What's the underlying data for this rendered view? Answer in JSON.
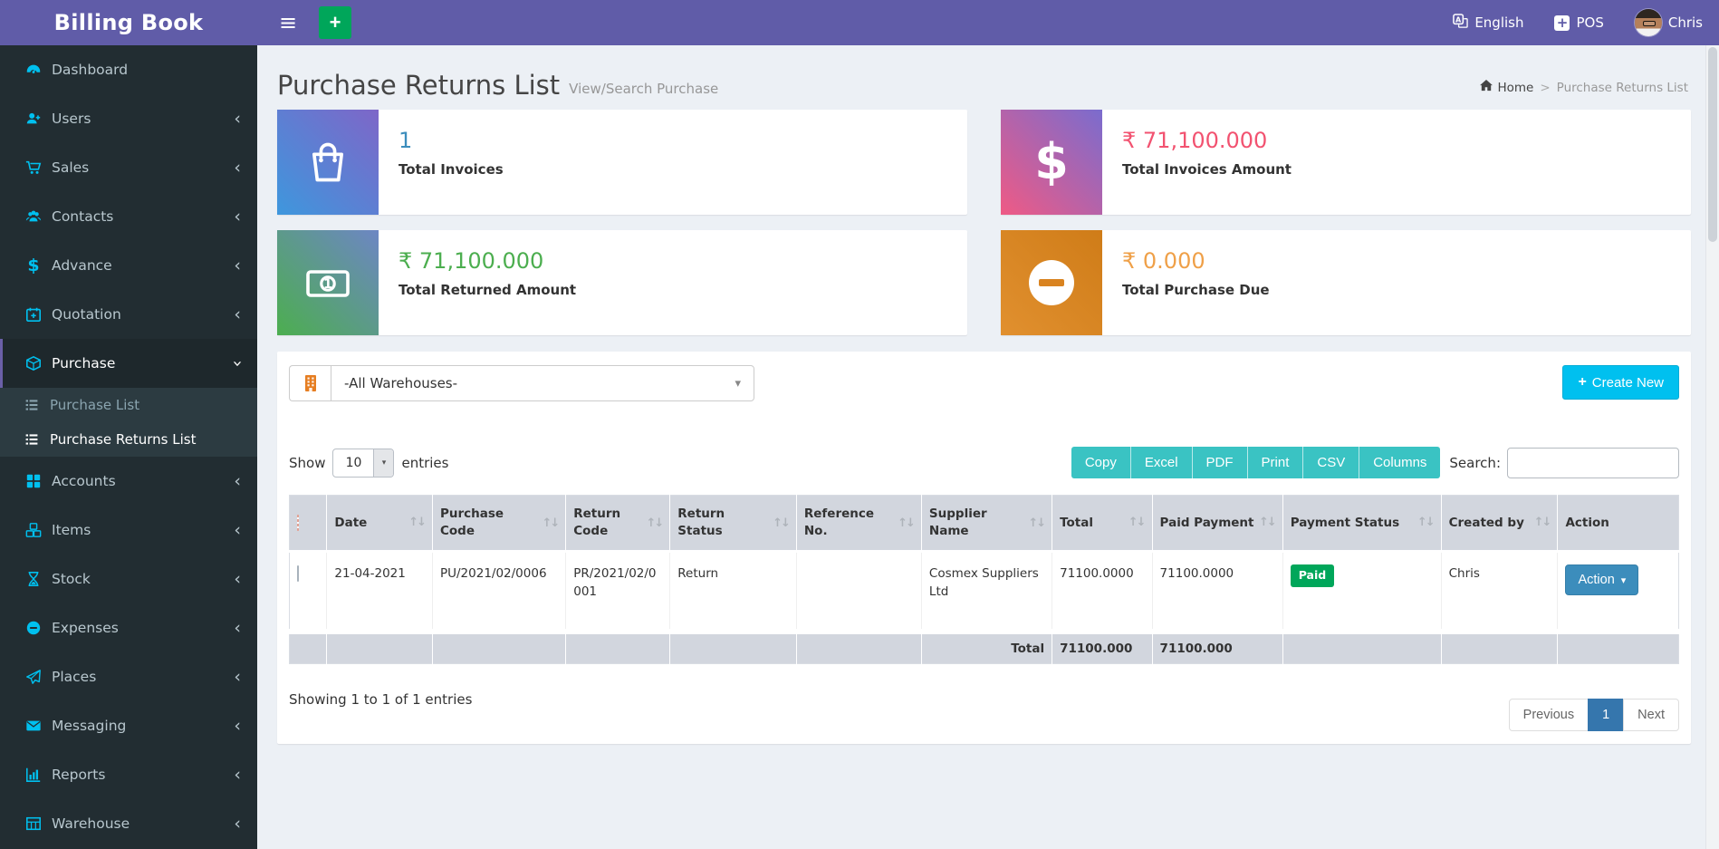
{
  "app": {
    "brand": "Billing Book"
  },
  "topbar": {
    "language_label": "English",
    "language_icon": "translate-icon",
    "pos_label": "POS",
    "pos_icon": "plus-square-icon",
    "username": "Chris",
    "quick_add_label": "+",
    "hamburger_icon": "hamburger-icon"
  },
  "page": {
    "title": "Purchase Returns List",
    "subtitle": "View/Search Purchase",
    "breadcrumb": {
      "home": "Home",
      "separator": ">",
      "current": "Purchase Returns List"
    }
  },
  "sidebar": {
    "items": [
      {
        "label": "Dashboard",
        "icon": "gauge-icon",
        "chevron": "none"
      },
      {
        "label": "Users",
        "icon": "user-plus-icon",
        "chevron": "left"
      },
      {
        "label": "Sales",
        "icon": "cart-icon",
        "chevron": "left"
      },
      {
        "label": "Contacts",
        "icon": "users-icon",
        "chevron": "left"
      },
      {
        "label": "Advance",
        "icon": "dollar-icon",
        "chevron": "left"
      },
      {
        "label": "Quotation",
        "icon": "calendar-plus-icon",
        "chevron": "left"
      },
      {
        "label": "Purchase",
        "icon": "cube-icon",
        "chevron": "down",
        "active": true
      },
      {
        "label": "Accounts",
        "icon": "grid-icon",
        "chevron": "left"
      },
      {
        "label": "Items",
        "icon": "cubes-icon",
        "chevron": "left"
      },
      {
        "label": "Stock",
        "icon": "hourglass-icon",
        "chevron": "left"
      },
      {
        "label": "Expenses",
        "icon": "minus-circle-icon",
        "chevron": "left"
      },
      {
        "label": "Places",
        "icon": "paper-plane-icon",
        "chevron": "left"
      },
      {
        "label": "Messaging",
        "icon": "envelope-icon",
        "chevron": "left"
      },
      {
        "label": "Reports",
        "icon": "bar-chart-icon",
        "chevron": "left"
      },
      {
        "label": "Warehouse",
        "icon": "table-icon",
        "chevron": "left"
      }
    ],
    "purchase_submenu": [
      {
        "label": "Purchase List",
        "icon": "list-icon",
        "active": false
      },
      {
        "label": "Purchase Returns List",
        "icon": "list-icon",
        "active": true
      }
    ]
  },
  "cards": [
    {
      "value": "1",
      "label": "Total Invoices",
      "icon": "shopping-bag-icon",
      "value_color": "#3c8dbc",
      "gradient": [
        "#3e97dd",
        "#7e66c8"
      ]
    },
    {
      "value": "₹ 71,100.000",
      "label": "Total Invoices Amount",
      "icon": "dollar-icon",
      "value_color": "#f25270",
      "gradient": [
        "#ef5a85",
        "#7a6cce"
      ]
    },
    {
      "value": "₹ 71,100.000",
      "label": "Total Returned Amount",
      "icon": "money-bill-icon",
      "value_color": "#4cae4f",
      "gradient": [
        "#4cae4f",
        "#6d86c4"
      ]
    },
    {
      "value": "₹ 0.000",
      "label": "Total Purchase Due",
      "icon": "minus-circle-icon",
      "value_color": "#efa048",
      "gradient": [
        "#e1902f",
        "#cf7c18"
      ]
    }
  ],
  "filters": {
    "warehouse_icon": "building-icon",
    "warehouse_selected": "-All Warehouses-",
    "create_new_label": "Create New"
  },
  "table_controls": {
    "show_label": "Show",
    "page_length": "10",
    "entries_label": "entries",
    "export_buttons": [
      "Copy",
      "Excel",
      "PDF",
      "Print",
      "CSV",
      "Columns"
    ],
    "search_label": "Search:",
    "search_value": ""
  },
  "table": {
    "headers": [
      "Date",
      "Purchase Code",
      "Return Code",
      "Return Status",
      "Reference No.",
      "Supplier Name",
      "Total",
      "Paid Payment",
      "Payment Status",
      "Created by",
      "Action"
    ],
    "rows": [
      {
        "date": "21-04-2021",
        "purchase_code": "PU/2021/02/0006",
        "return_code": "PR/2021/02/0001",
        "return_status": "Return",
        "reference_no": "",
        "supplier_name": "Cosmex Suppliers Ltd",
        "total": "71100.0000",
        "paid_payment": "71100.0000",
        "payment_status": "Paid",
        "created_by": "Chris",
        "action_label": "Action"
      }
    ],
    "footer": {
      "total_label": "Total",
      "total": "71100.000",
      "paid_payment": "71100.000"
    }
  },
  "pagination": {
    "info": "Showing 1 to 1 of 1 entries",
    "previous_label": "Previous",
    "current_page": "1",
    "next_label": "Next"
  },
  "colors": {
    "header_purple": "#605ca8",
    "sidebar_dark": "#222d32",
    "icon_cyan": "#00c0ef",
    "export_teal": "#3ac3c3",
    "create_cyan": "#00c0ef",
    "action_blue": "#3c8dbc",
    "paid_green": "#00a65a",
    "table_head_grey": "#d2d6de"
  }
}
